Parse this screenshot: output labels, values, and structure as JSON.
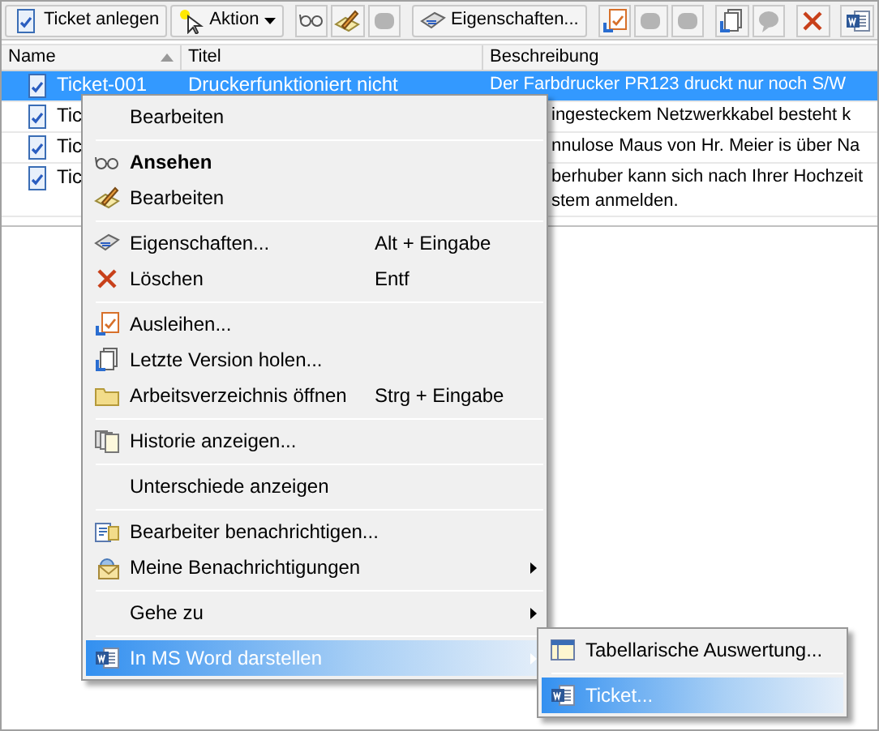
{
  "toolbar": [
    {
      "kind": "button",
      "label": "Ticket anlegen",
      "disabled": false
    },
    {
      "kind": "dropdown",
      "label": "Aktion",
      "disabled": false
    },
    {
      "kind": "separator"
    },
    {
      "kind": "icon",
      "disabled": false
    },
    {
      "kind": "icon",
      "disabled": false
    },
    {
      "kind": "icon",
      "disabled": true
    },
    {
      "kind": "separator"
    },
    {
      "kind": "button",
      "label": "Eigenschaften...",
      "disabled": false
    },
    {
      "kind": "separator"
    },
    {
      "kind": "icon",
      "disabled": false
    },
    {
      "kind": "icon",
      "disabled": true
    },
    {
      "kind": "icon",
      "disabled": true
    },
    {
      "kind": "separator"
    },
    {
      "kind": "icon",
      "disabled": false
    },
    {
      "kind": "icon",
      "disabled": true
    },
    {
      "kind": "separator"
    },
    {
      "kind": "icon",
      "disabled": false
    },
    {
      "kind": "separator"
    },
    {
      "kind": "icon",
      "disabled": false
    }
  ],
  "table": {
    "columns": [
      {
        "label": "Name",
        "sorted_ascending": true
      },
      {
        "label": "Titel",
        "sorted_ascending": false
      },
      {
        "label": "Beschreibung",
        "sorted_ascending": false
      }
    ],
    "rows": [
      {
        "name": "Ticket-001",
        "title": "Druckerfunktioniert nicht",
        "description": [
          "Der Farbdrucker PR123 druckt nur noch S/W"
        ],
        "selected": true,
        "covered": false
      },
      {
        "name": "Tic",
        "description": [
          "ingesteckem Netzwerkkabel besteht k"
        ],
        "selected": false,
        "covered": true
      },
      {
        "name": "Tic",
        "description": [
          "nnulose Maus von Hr. Meier is über Na"
        ],
        "selected": false,
        "covered": true
      },
      {
        "name": "Tic",
        "description": [
          "berhuber kann sich nach Ihrer Hochzeit",
          "stem anmelden."
        ],
        "selected": false,
        "covered": true
      }
    ]
  },
  "context_menu": {
    "items": [
      {
        "kind": "item",
        "label": "Bearbeiten",
        "default": false,
        "submenu": false,
        "highlighted": false
      },
      {
        "kind": "separator"
      },
      {
        "kind": "item",
        "label": "Ansehen",
        "default": true,
        "submenu": false,
        "highlighted": false
      },
      {
        "kind": "item",
        "label": "Bearbeiten",
        "default": false,
        "submenu": false,
        "highlighted": false
      },
      {
        "kind": "separator"
      },
      {
        "kind": "item",
        "label": "Eigenschaften...",
        "shortcut": "Alt + Eingabe",
        "default": false,
        "submenu": false,
        "highlighted": false
      },
      {
        "kind": "item",
        "label": "Löschen",
        "shortcut": "Entf",
        "default": false,
        "submenu": false,
        "highlighted": false
      },
      {
        "kind": "separator"
      },
      {
        "kind": "item",
        "label": "Ausleihen...",
        "default": false,
        "submenu": false,
        "highlighted": false
      },
      {
        "kind": "item",
        "label": "Letzte Version holen...",
        "default": false,
        "submenu": false,
        "highlighted": false
      },
      {
        "kind": "item",
        "label": "Arbeitsverzeichnis öffnen",
        "shortcut": "Strg + Eingabe",
        "default": false,
        "submenu": false,
        "highlighted": false
      },
      {
        "kind": "separator"
      },
      {
        "kind": "item",
        "label": "Historie anzeigen...",
        "default": false,
        "submenu": false,
        "highlighted": false
      },
      {
        "kind": "separator"
      },
      {
        "kind": "item",
        "label": "Unterschiede anzeigen",
        "default": false,
        "submenu": false,
        "highlighted": false
      },
      {
        "kind": "separator"
      },
      {
        "kind": "item",
        "label": "Bearbeiter benachrichtigen...",
        "default": false,
        "submenu": false,
        "highlighted": false
      },
      {
        "kind": "item",
        "label": "Meine Benachrichtigungen",
        "default": false,
        "submenu": true,
        "highlighted": false
      },
      {
        "kind": "separator"
      },
      {
        "kind": "item",
        "label": "Gehe zu",
        "default": false,
        "submenu": true,
        "highlighted": false
      },
      {
        "kind": "separator"
      },
      {
        "kind": "item",
        "label": "In MS Word darstellen",
        "default": false,
        "submenu": true,
        "highlighted": true
      }
    ]
  },
  "submenu": {
    "items": [
      {
        "kind": "item",
        "label": "Tabellarische Auswertung...",
        "default": false,
        "submenu": false,
        "highlighted": false
      },
      {
        "kind": "separator"
      },
      {
        "kind": "item",
        "label": "Ticket...",
        "default": false,
        "submenu": false,
        "highlighted": true
      }
    ]
  }
}
